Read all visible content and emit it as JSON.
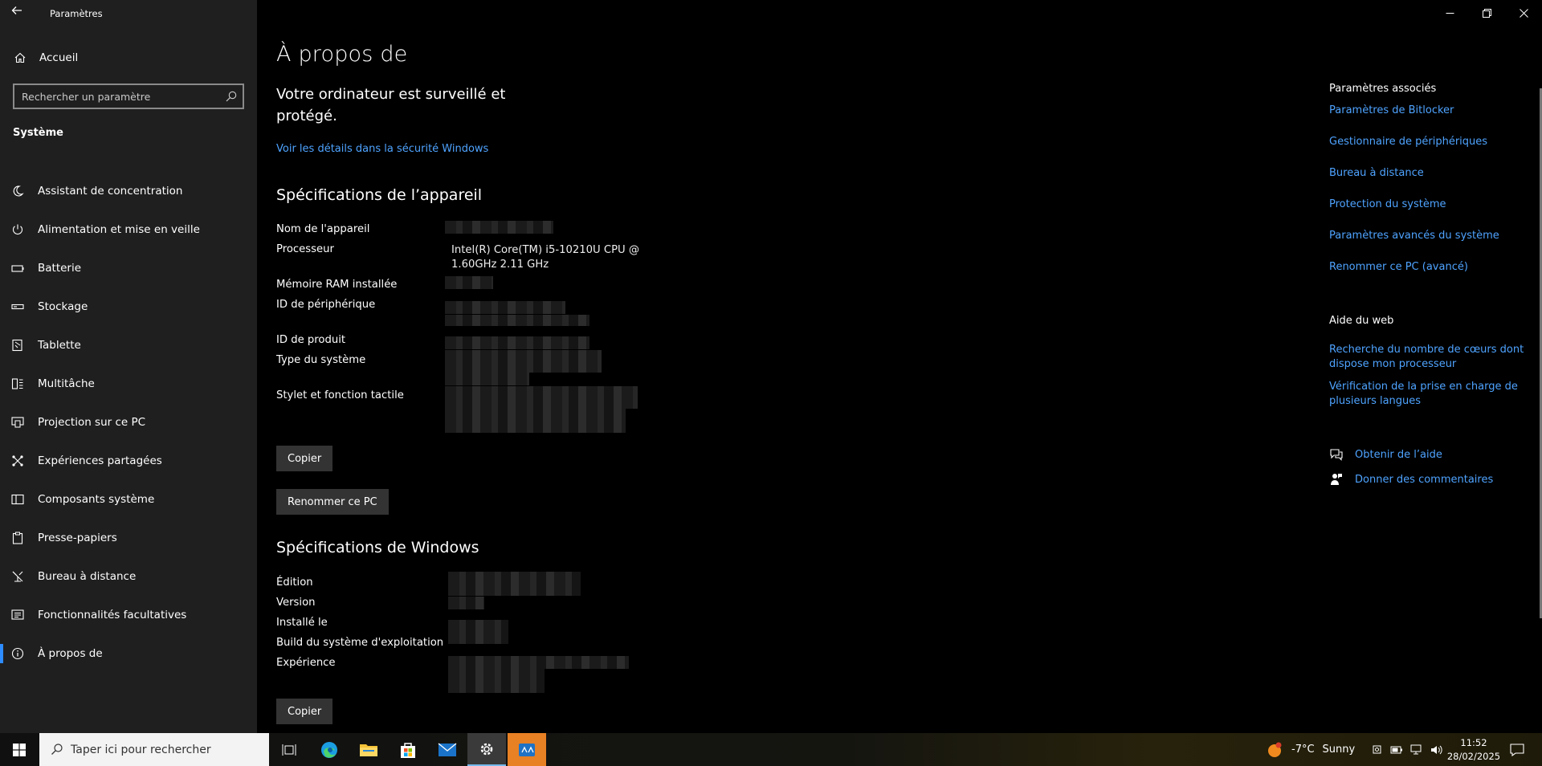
{
  "window": {
    "title": "Paramètres"
  },
  "sidebar": {
    "home_label": "Accueil",
    "search_placeholder": "Rechercher un paramètre",
    "section_title": "Système",
    "items": [
      {
        "label": "Assistant de concentration",
        "icon": "moon-icon"
      },
      {
        "label": "Alimentation et mise en veille",
        "icon": "power-icon"
      },
      {
        "label": "Batterie",
        "icon": "battery-icon"
      },
      {
        "label": "Stockage",
        "icon": "storage-icon"
      },
      {
        "label": "Tablette",
        "icon": "tablet-icon"
      },
      {
        "label": "Multitâche",
        "icon": "multitask-icon"
      },
      {
        "label": "Projection sur ce PC",
        "icon": "projection-icon"
      },
      {
        "label": "Expériences partagées",
        "icon": "shared-icon"
      },
      {
        "label": "Composants système",
        "icon": "components-icon"
      },
      {
        "label": "Presse-papiers",
        "icon": "clipboard-icon"
      },
      {
        "label": "Bureau à distance",
        "icon": "remote-desktop-icon"
      },
      {
        "label": "Fonctionnalités facultatives",
        "icon": "optional-features-icon"
      },
      {
        "label": "À propos de",
        "icon": "info-icon",
        "active": true
      }
    ]
  },
  "main": {
    "title": "À propos de",
    "status": "Votre ordinateur est surveillé et protégé.",
    "security_link": "Voir les détails dans la sécurité Windows",
    "device_specs": {
      "heading": "Spécifications de l’appareil",
      "rows": [
        {
          "label": "Nom de l'appareil"
        },
        {
          "label": "Processeur",
          "value": "Intel(R) Core(TM) i5-10210U CPU @ 1.60GHz   2.11 GHz"
        },
        {
          "label": "Mémoire RAM installée"
        },
        {
          "label": "ID de périphérique"
        },
        {
          "label": "ID de produit"
        },
        {
          "label": "Type du système"
        },
        {
          "label": "Stylet et fonction tactile"
        }
      ],
      "copy_button": "Copier",
      "rename_button": "Renommer ce PC"
    },
    "windows_specs": {
      "heading": "Spécifications de Windows",
      "rows": [
        {
          "label": "Édition"
        },
        {
          "label": "Version"
        },
        {
          "label": "Installé le"
        },
        {
          "label": "Build du système d'exploitation"
        },
        {
          "label": "Expérience"
        }
      ],
      "copy_button": "Copier"
    }
  },
  "related": {
    "heading": "Paramètres associés",
    "links": [
      "Paramètres de Bitlocker",
      "Gestionnaire de périphériques",
      "Bureau à distance",
      "Protection du système",
      "Paramètres avancés du système",
      "Renommer ce PC (avancé)"
    ],
    "web_heading": "Aide du web",
    "web_links": [
      "Recherche du nombre de cœurs dont dispose mon processeur",
      "Vérification de la prise en charge de plusieurs langues"
    ],
    "help_label": "Obtenir de l’aide",
    "feedback_label": "Donner des commentaires"
  },
  "taskbar": {
    "search_placeholder": "Taper ici pour rechercher",
    "weather_temp": "-7°C",
    "weather_text": "Sunny",
    "time": "11:52",
    "date": "28/02/2025"
  },
  "colors": {
    "accent": "#2d8cff",
    "link": "#4ea3ff",
    "sidebar_bg": "#1f1f1f",
    "main_bg": "#000000"
  }
}
